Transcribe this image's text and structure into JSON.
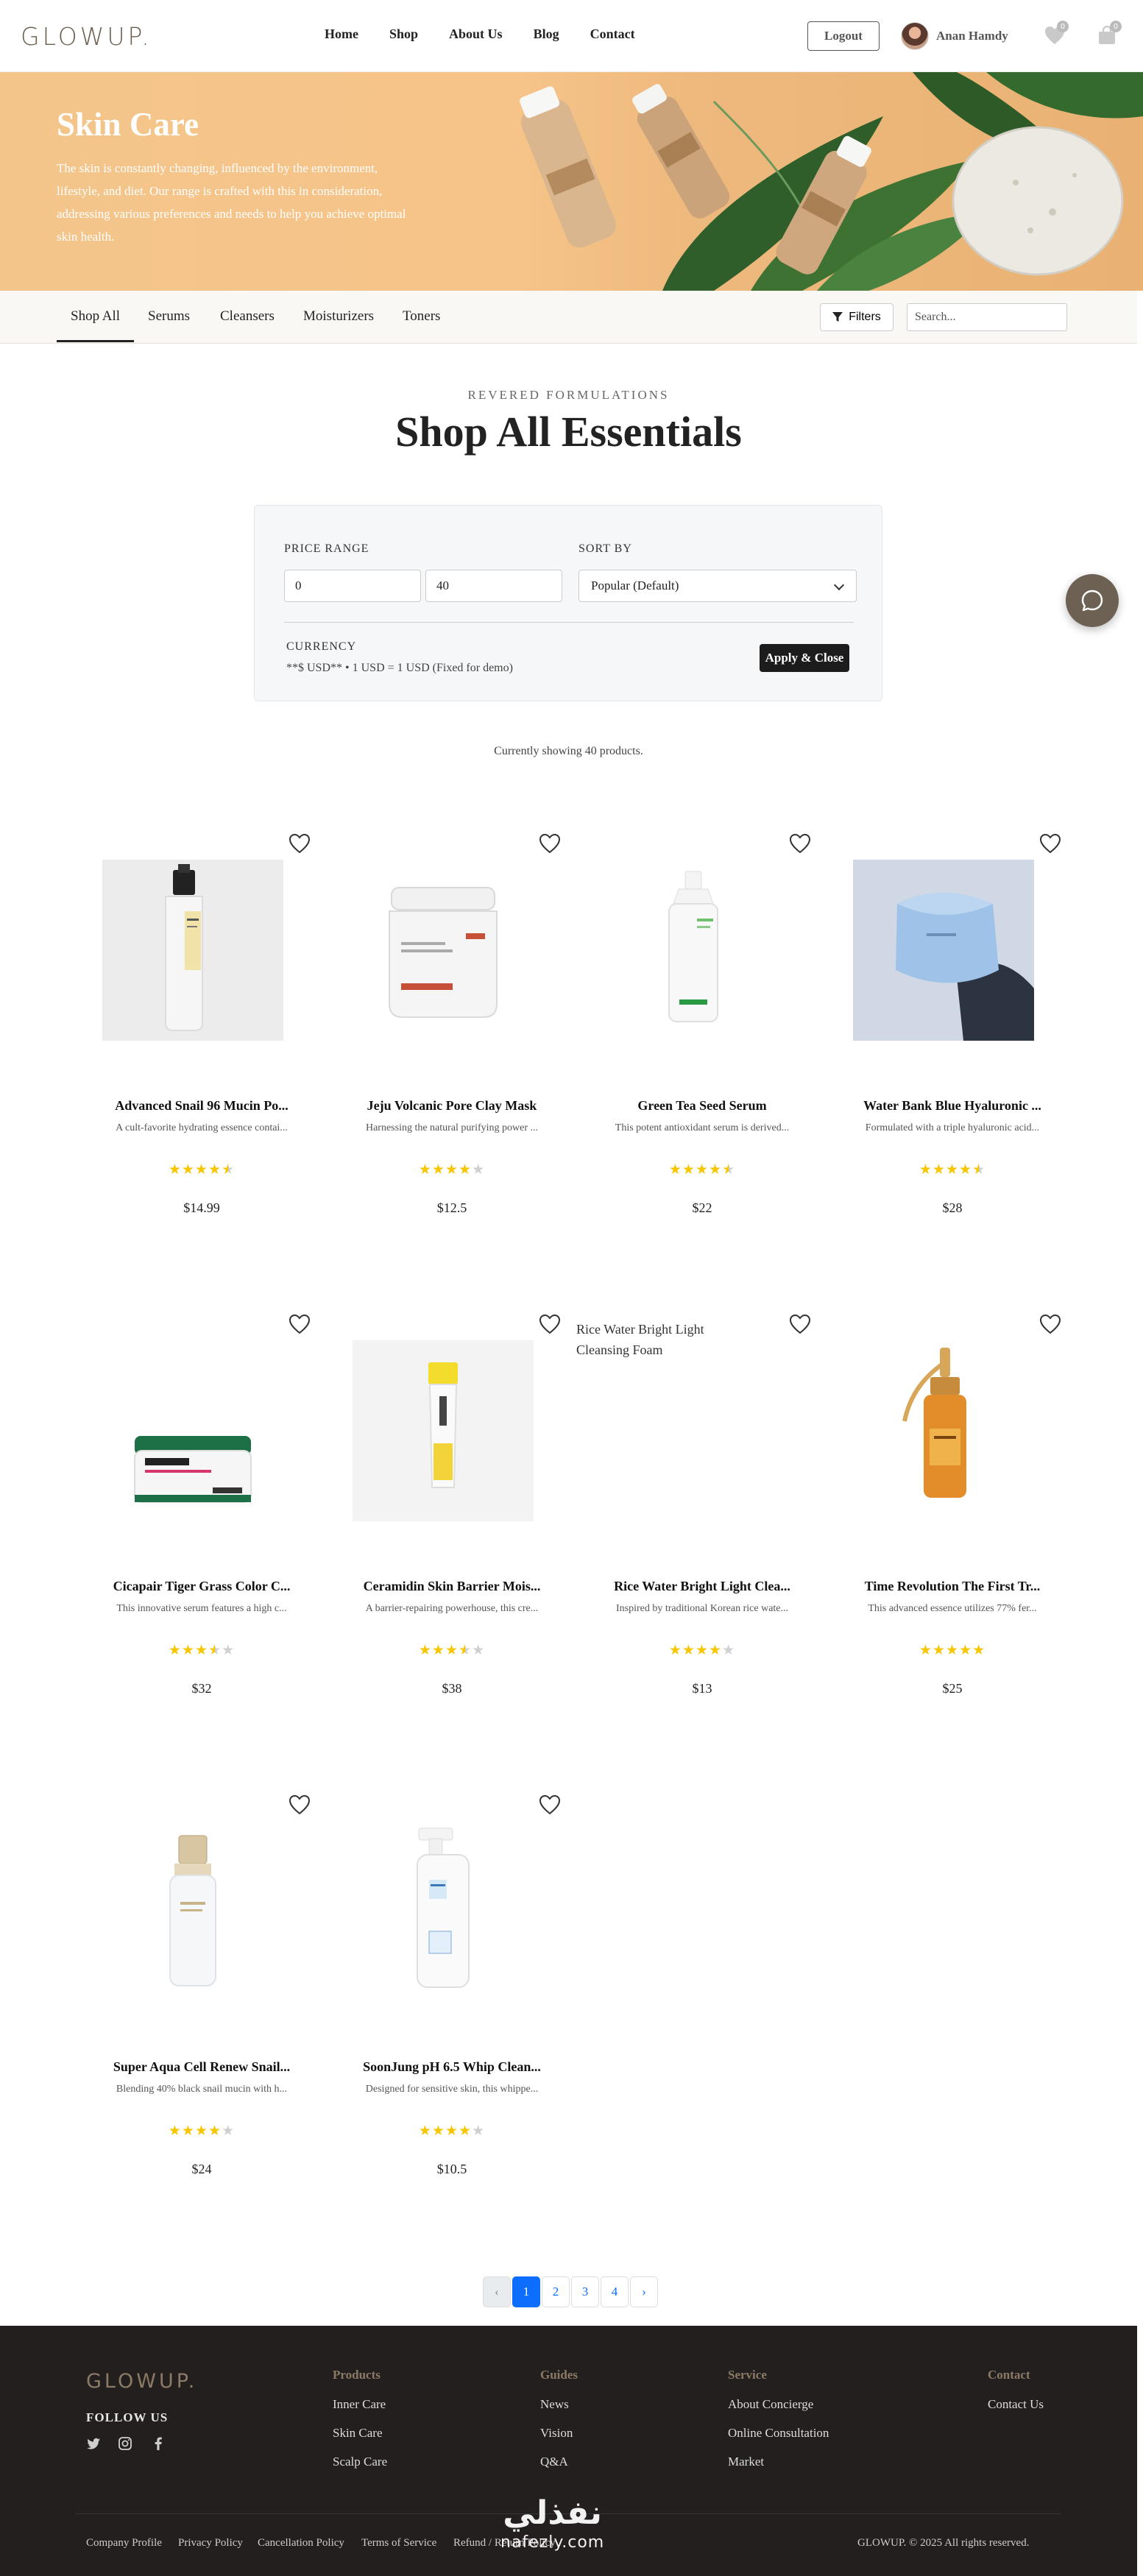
{
  "brand": {
    "logo": "GLOWUP."
  },
  "header": {
    "nav": [
      "Home",
      "Shop",
      "About Us",
      "Blog",
      "Contact"
    ],
    "logout_label": "Logout",
    "user_name": "Anan Hamdy",
    "wishlist_count": "0",
    "cart_count": "0"
  },
  "hero": {
    "title": "Skin Care",
    "description": "The skin is constantly changing, influenced by the environment, lifestyle, and diet. Our range is crafted with this in consideration, addressing various preferences and needs to help you achieve optimal skin health."
  },
  "categories": {
    "tabs": [
      "Shop All",
      "Serums",
      "Cleansers",
      "Moisturizers",
      "Toners"
    ],
    "active": "Shop All",
    "filters_label": "Filters",
    "search_placeholder": "Search..."
  },
  "section": {
    "eyebrow": "REVERED FORMULATIONS",
    "title": "Shop All Essentials"
  },
  "filter_panel": {
    "price_label": "PRICE RANGE",
    "price_min": "0",
    "price_max": "40",
    "sort_label": "SORT BY",
    "sort_value": "Popular (Default)",
    "currency_label": "CURRENCY",
    "currency_value": "**$ USD** • 1 USD = 1 USD (Fixed for demo)",
    "apply_label": "Apply & Close"
  },
  "showing_text": "Currently showing 40 products.",
  "products": [
    {
      "name": "Advanced Snail 96 Mucin Po...",
      "desc": "A cult-favorite hydrating essence contai...",
      "stars": "★★★★★",
      "rating": 4.5,
      "price": "$14.99",
      "image": "snail-essence-bottle"
    },
    {
      "name": "Jeju Volcanic Pore Clay Mask",
      "desc": "Harnessing the natural purifying power ...",
      "stars": "★★★★☆",
      "rating": 4,
      "price": "$12.5",
      "image": "clay-mask-jar"
    },
    {
      "name": "Green Tea Seed Serum",
      "desc": "This potent antioxidant serum is derived...",
      "stars": "★★★★★",
      "rating": 4.5,
      "price": "$22",
      "image": "green-tea-serum-bottle"
    },
    {
      "name": "Water Bank Blue Hyaluronic ...",
      "desc": "Formulated with a triple hyaluronic acid...",
      "stars": "★★★★★",
      "rating": 4.5,
      "price": "$28",
      "image": "blue-cream-jar"
    },
    {
      "name": "Cicapair Tiger Grass Color C...",
      "desc": "This innovative serum features a high c...",
      "stars": "★★★★☆",
      "rating": 3.5,
      "price": "$32",
      "image": "cicapair-jar"
    },
    {
      "name": "Ceramidin Skin Barrier Mois...",
      "desc": "A barrier-repairing powerhouse, this cre...",
      "stars": "★★★★☆",
      "rating": 3.5,
      "price": "$38",
      "image": "ceramidin-tube"
    },
    {
      "name": "Rice Water Bright Light Clea...",
      "desc": "Inspired by traditional Korean rice wate...",
      "stars": "★★★★☆",
      "rating": 4,
      "price": "$13",
      "image": "broken",
      "alt": "Rice Water Bright Light Cleansing Foam"
    },
    {
      "name": "Time Revolution The First Tr...",
      "desc": "This advanced essence utilizes 77% fer...",
      "stars": "★★★★★",
      "rating": 5,
      "price": "$25",
      "image": "amber-dropper-bottle"
    },
    {
      "name": "Super Aqua Cell Renew Snail...",
      "desc": "Blending 40% black snail mucin with h...",
      "stars": "★★★★☆",
      "rating": 4,
      "price": "$24",
      "image": "aqua-cell-bottle"
    },
    {
      "name": "SoonJung pH 6.5 Whip Clean...",
      "desc": "Designed for sensitive skin, this whippe...",
      "stars": "★★★★☆",
      "rating": 4,
      "price": "$10.5",
      "image": "soonjung-foam-pump"
    }
  ],
  "pagination": {
    "prev": "‹",
    "pages": [
      "1",
      "2",
      "3",
      "4"
    ],
    "active": "1",
    "next": "›"
  },
  "footer": {
    "logo": "GLOWUP.",
    "follow": "FOLLOW US",
    "columns": [
      {
        "title": "Products",
        "links": [
          "Inner Care",
          "Skin Care",
          "Scalp Care"
        ]
      },
      {
        "title": "Guides",
        "links": [
          "News",
          "Vision",
          "Q&A"
        ]
      },
      {
        "title": "Service",
        "links": [
          "About Concierge",
          "Online Consultation",
          "Market"
        ]
      },
      {
        "title": "Contact",
        "links": [
          "Contact Us"
        ]
      }
    ],
    "bottom_links": [
      "Company Profile",
      "Privacy Policy",
      "Cancellation Policy",
      "Terms of Service",
      "Refund / Return Policy"
    ],
    "copyright": "GLOWUP. © 2025 All rights reserved."
  },
  "watermark": {
    "arabic": "نفذلي",
    "latin": "nafezly.com"
  },
  "colors": {
    "accent": "#0d6efd",
    "star": "#f7c600",
    "footer_bg": "#231f1e",
    "hero_bg": "#f4c58a"
  }
}
